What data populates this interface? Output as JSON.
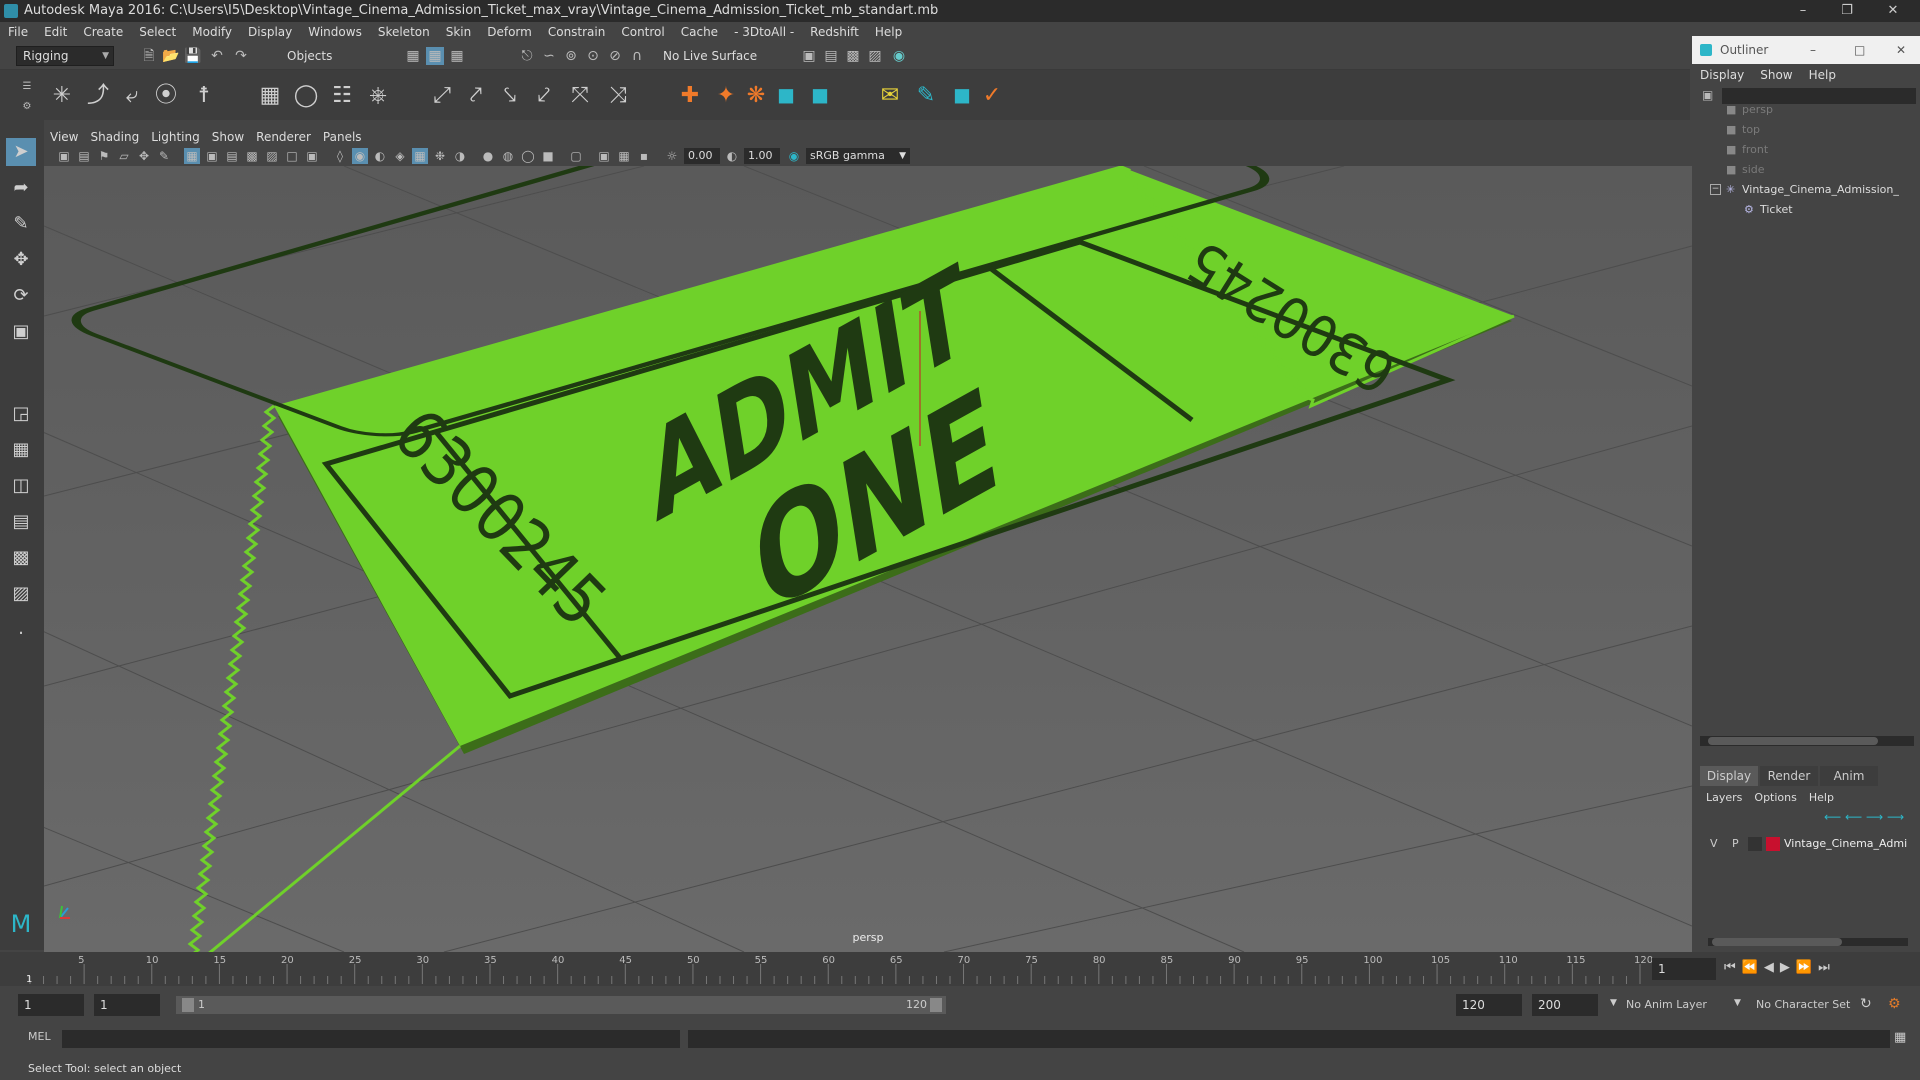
{
  "window": {
    "title": "Autodesk Maya 2016: C:\\Users\\I5\\Desktop\\Vintage_Cinema_Admission_Ticket_max_vray\\Vintage_Cinema_Admission_Ticket_mb_standart.mb"
  },
  "menubar": [
    "File",
    "Edit",
    "Create",
    "Select",
    "Modify",
    "Display",
    "Windows",
    "Skeleton",
    "Skin",
    "Deform",
    "Constrain",
    "Control",
    "Cache",
    "- 3DtoAll -",
    "Redshift",
    "Help"
  ],
  "toolbar": {
    "mode": "Rigging",
    "select_mode": "Objects",
    "live_surface": "No Live Surface"
  },
  "panel": {
    "menu": [
      "View",
      "Shading",
      "Lighting",
      "Show",
      "Renderer",
      "Panels"
    ],
    "exposure": "0.00",
    "gamma": "1.00",
    "colorspace": "sRGB gamma",
    "camera_label": "persp"
  },
  "ticket": {
    "headline_1": "ADMIT",
    "headline_2": "ONE",
    "serial": "6300245",
    "serial_left": "6300245",
    "color": "#6fd12a",
    "ink": "#1f3a12"
  },
  "outliner": {
    "title": "Outliner",
    "menu": [
      "Display",
      "Show",
      "Help"
    ],
    "items": [
      {
        "label": "persp",
        "dim": true
      },
      {
        "label": "top",
        "dim": true
      },
      {
        "label": "front",
        "dim": true
      },
      {
        "label": "side",
        "dim": true
      },
      {
        "label": "Vintage_Cinema_Admission_",
        "dim": false
      },
      {
        "label": "Ticket",
        "dim": false
      }
    ]
  },
  "layers": {
    "tabs": [
      "Display",
      "Render",
      "Anim"
    ],
    "menu": [
      "Layers",
      "Options",
      "Help"
    ],
    "row": {
      "v": "V",
      "p": "P",
      "name": "Vintage_Cinema_Admi",
      "color": "#c8102e"
    }
  },
  "timeline": {
    "ticks": [
      "5",
      "10",
      "15",
      "20",
      "25",
      "30",
      "35",
      "40",
      "45",
      "50",
      "55",
      "60",
      "65",
      "70",
      "75",
      "80",
      "85",
      "90",
      "95",
      "100",
      "105",
      "110",
      "115",
      "120"
    ],
    "start_label": "1",
    "current_frame": "1"
  },
  "range": {
    "start": "1",
    "playback_start": "1",
    "slider_start": "1",
    "slider_end": "120",
    "playback_end": "120",
    "end": "200",
    "anim_layer": "No Anim Layer",
    "char_set": "No Character Set"
  },
  "mel": {
    "label": "MEL"
  },
  "status": {
    "text": "Select Tool: select an object"
  }
}
